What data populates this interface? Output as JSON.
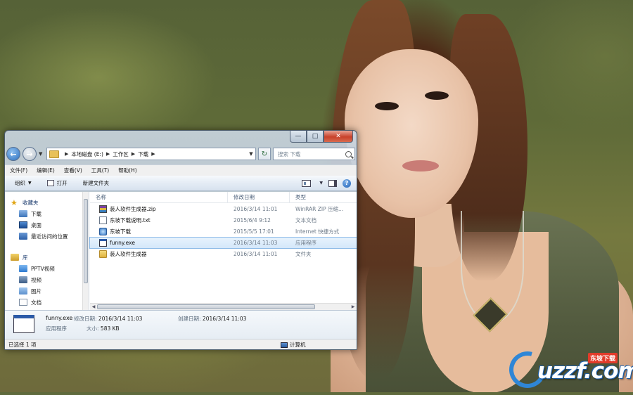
{
  "window": {
    "breadcrumb": [
      "本地磁盘 (E:)",
      "工作区",
      "下载"
    ],
    "search_placeholder": "搜索 下载"
  },
  "menu": [
    "文件(F)",
    "编辑(E)",
    "查看(V)",
    "工具(T)",
    "帮助(H)"
  ],
  "toolbar": {
    "organize": "组织",
    "open": "打开",
    "new_folder": "新建文件夹"
  },
  "nav": {
    "favorites_head": "收藏夹",
    "favorites": [
      "下载",
      "桌面",
      "最近访问的位置"
    ],
    "libraries_head": "库",
    "libraries": [
      "PPTV视频",
      "视频",
      "图片",
      "文档"
    ]
  },
  "columns": {
    "name": "名称",
    "date": "修改日期",
    "type": "类型"
  },
  "files": [
    {
      "name": "装人软件生成器.zip",
      "date": "2016/3/14 11:01",
      "type": "WinRAR ZIP 压缩...",
      "icon": "zip-icon"
    },
    {
      "name": "东坡下载说明.txt",
      "date": "2015/6/4 9:12",
      "type": "文本文档",
      "icon": "text-file-icon"
    },
    {
      "name": "东坡下载",
      "date": "2015/5/5 17:01",
      "type": "Internet 快捷方式",
      "icon": "internet-shortcut-icon"
    },
    {
      "name": "funny.exe",
      "date": "2016/3/14 11:03",
      "type": "应用程序",
      "icon": "exe-icon"
    },
    {
      "name": "装人软件生成器",
      "date": "2016/3/14 11:01",
      "type": "文件夹",
      "icon": "folder-icon"
    }
  ],
  "selected_index": 3,
  "details": {
    "name": "funny.exe",
    "kind": "应用程序",
    "modified_label": "修改日期:",
    "modified": "2016/3/14 11:03",
    "created_label": "创建日期:",
    "created": "2016/3/14 11:03",
    "size_label": "大小:",
    "size": "583 KB"
  },
  "status": {
    "selection": "已选择 1 项",
    "location": "计算机"
  },
  "logo": {
    "text": "uzzf.com",
    "badge": "东坡下载"
  }
}
